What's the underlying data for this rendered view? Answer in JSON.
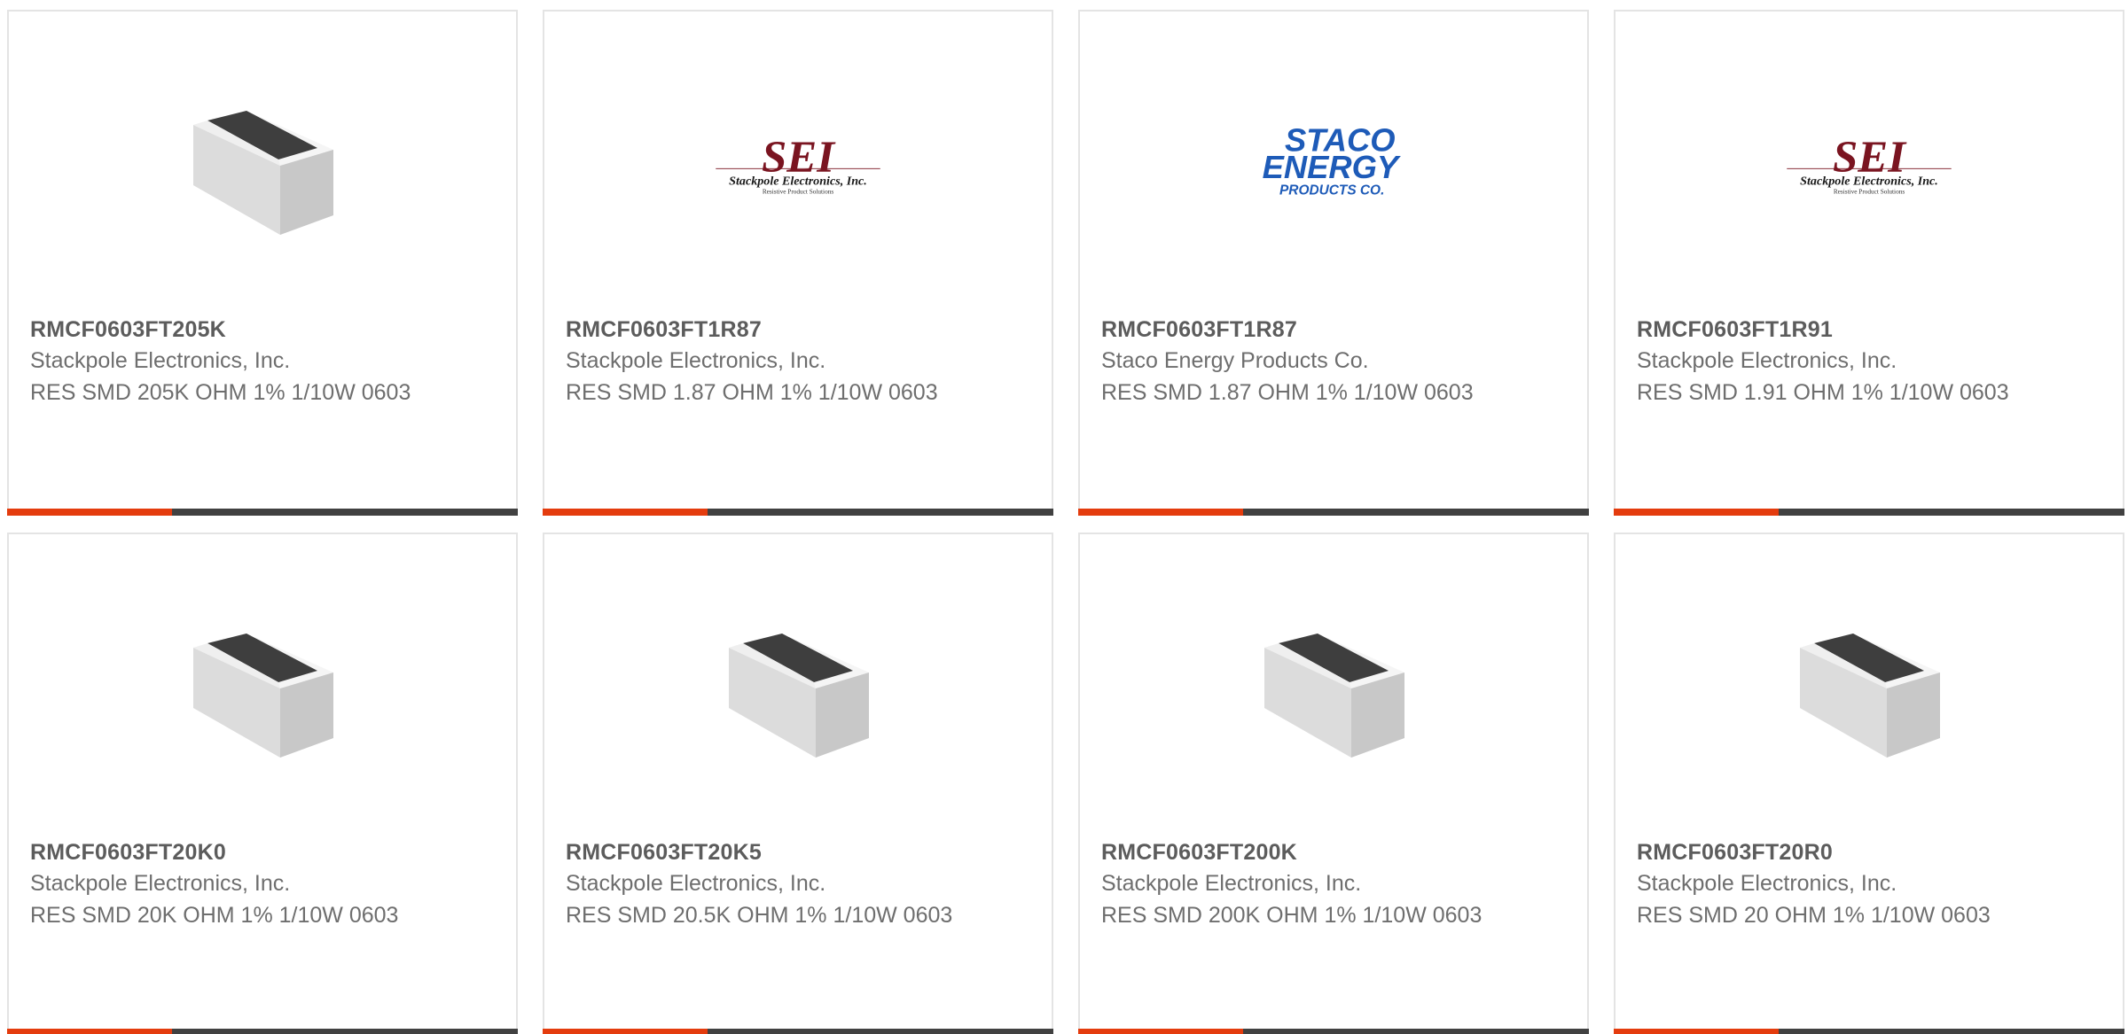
{
  "products": [
    {
      "part": "RMCF0603FT205K",
      "manufacturer": "Stackpole Electronics, Inc.",
      "description": "RES SMD 205K OHM 1% 1/10W 0603",
      "image": "resistor-chip"
    },
    {
      "part": "RMCF0603FT1R87",
      "manufacturer": "Stackpole Electronics, Inc.",
      "description": "RES SMD 1.87 OHM 1% 1/10W 0603",
      "image": "sei-logo"
    },
    {
      "part": "RMCF0603FT1R87",
      "manufacturer": "Staco Energy Products Co.",
      "description": "RES SMD 1.87 OHM 1% 1/10W 0603",
      "image": "staco-logo"
    },
    {
      "part": "RMCF0603FT1R91",
      "manufacturer": "Stackpole Electronics, Inc.",
      "description": "RES SMD 1.91 OHM 1% 1/10W 0603",
      "image": "sei-logo"
    },
    {
      "part": "RMCF0603FT20K0",
      "manufacturer": "Stackpole Electronics, Inc.",
      "description": "RES SMD 20K OHM 1% 1/10W 0603",
      "image": "resistor-chip"
    },
    {
      "part": "RMCF0603FT20K5",
      "manufacturer": "Stackpole Electronics, Inc.",
      "description": "RES SMD 20.5K OHM 1% 1/10W 0603",
      "image": "resistor-chip"
    },
    {
      "part": "RMCF0603FT200K",
      "manufacturer": "Stackpole Electronics, Inc.",
      "description": "RES SMD 200K OHM 1% 1/10W 0603",
      "image": "resistor-chip"
    },
    {
      "part": "RMCF0603FT20R0",
      "manufacturer": "Stackpole Electronics, Inc.",
      "description": "RES SMD 20 OHM 1% 1/10W 0603",
      "image": "resistor-chip"
    }
  ],
  "logos": {
    "sei": {
      "mark": "SEI",
      "name": "Stackpole Electronics, Inc.",
      "tagline": "Resistive Product Solutions"
    },
    "staco": {
      "line1": "STACO",
      "line2": "ENERGY",
      "line3": "PRODUCTS CO."
    }
  },
  "colors": {
    "accent": "#e43c0e",
    "bar": "#414141",
    "border": "#e4e4e4",
    "part_text": "#5c5c5c",
    "body_text": "#6e6e6e",
    "sei_red": "#7a1420",
    "staco_blue": "#1e5bb8"
  }
}
